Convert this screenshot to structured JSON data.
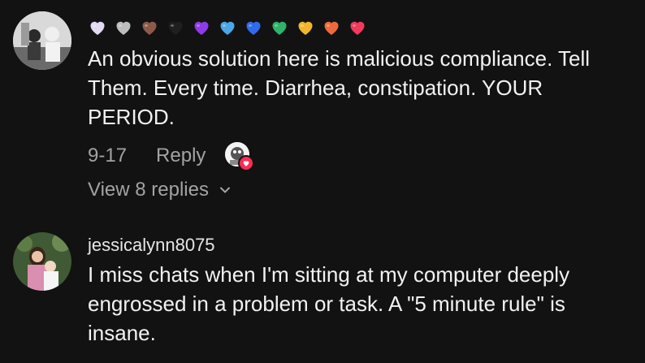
{
  "comments": [
    {
      "hearts": [
        {
          "icon": "lavender-heart-icon",
          "color": "#e2d9f3"
        },
        {
          "icon": "grey-heart-icon",
          "color": "#bdbdbd"
        },
        {
          "icon": "brown-heart-icon",
          "color": "#8d5a4a"
        },
        {
          "icon": "black-heart-icon",
          "color": "#1f1f1f"
        },
        {
          "icon": "purple-heart-icon",
          "color": "#8e3be8"
        },
        {
          "icon": "light-blue-heart-icon",
          "color": "#4aa8e8"
        },
        {
          "icon": "blue-heart-icon",
          "color": "#2f6bf0"
        },
        {
          "icon": "green-heart-icon",
          "color": "#2fb36a"
        },
        {
          "icon": "yellow-heart-icon",
          "color": "#f1b72a"
        },
        {
          "icon": "orange-heart-icon",
          "color": "#ef6a3a"
        },
        {
          "icon": "red-heart-icon",
          "color": "#f23b5c"
        }
      ],
      "text": "An obvious solution here is malicious compliance. Tell Them. Every time. Diarrhea, constipation. YOUR PERIOD.",
      "date": "9-17",
      "reply_label": "Reply",
      "view_replies": "View 8 replies",
      "creator_liked": true
    },
    {
      "username": "jessicalynn8075",
      "text": "I miss chats when I'm sitting at my computer deeply engrossed in a problem or task. A \"5 minute rule\" is insane."
    }
  ],
  "colors": {
    "background": "#121212",
    "text": "#f2f2f2",
    "muted": "#a3a3a3",
    "like_badge": "#fe2c55"
  }
}
